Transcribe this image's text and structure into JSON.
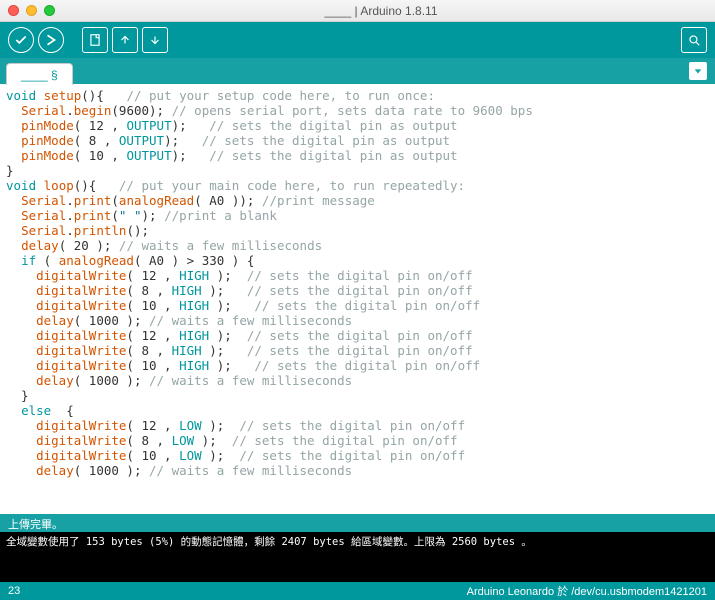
{
  "titlebar": {
    "title": "____ | Arduino 1.8.11"
  },
  "tab": {
    "label": "____ §"
  },
  "code_lines": [
    [
      {
        "t": "kw",
        "v": "void"
      },
      {
        "t": "p",
        "v": " "
      },
      {
        "t": "fn",
        "v": "setup"
      },
      {
        "t": "p",
        "v": "(){   "
      },
      {
        "t": "cm",
        "v": "// put your setup code here, to run once:"
      }
    ],
    [
      {
        "t": "p",
        "v": "  "
      },
      {
        "t": "fn",
        "v": "Serial"
      },
      {
        "t": "p",
        "v": "."
      },
      {
        "t": "fn",
        "v": "begin"
      },
      {
        "t": "p",
        "v": "(9600); "
      },
      {
        "t": "cm",
        "v": "// opens serial port, sets data rate to 9600 bps"
      }
    ],
    [
      {
        "t": "p",
        "v": "  "
      },
      {
        "t": "fn",
        "v": "pinMode"
      },
      {
        "t": "p",
        "v": "( 12 , "
      },
      {
        "t": "kw",
        "v": "OUTPUT"
      },
      {
        "t": "p",
        "v": ");   "
      },
      {
        "t": "cm",
        "v": "// sets the digital pin as output"
      }
    ],
    [
      {
        "t": "p",
        "v": "  "
      },
      {
        "t": "fn",
        "v": "pinMode"
      },
      {
        "t": "p",
        "v": "( 8 , "
      },
      {
        "t": "kw",
        "v": "OUTPUT"
      },
      {
        "t": "p",
        "v": ");   "
      },
      {
        "t": "cm",
        "v": "// sets the digital pin as output"
      }
    ],
    [
      {
        "t": "p",
        "v": "  "
      },
      {
        "t": "fn",
        "v": "pinMode"
      },
      {
        "t": "p",
        "v": "( 10 , "
      },
      {
        "t": "kw",
        "v": "OUTPUT"
      },
      {
        "t": "p",
        "v": ");   "
      },
      {
        "t": "cm",
        "v": "// sets the digital pin as output"
      }
    ],
    [
      {
        "t": "p",
        "v": "}"
      }
    ],
    [
      {
        "t": "p",
        "v": ""
      }
    ],
    [
      {
        "t": "kw",
        "v": "void"
      },
      {
        "t": "p",
        "v": " "
      },
      {
        "t": "fn",
        "v": "loop"
      },
      {
        "t": "p",
        "v": "(){   "
      },
      {
        "t": "cm",
        "v": "// put your main code here, to run repeatedly:"
      }
    ],
    [
      {
        "t": "p",
        "v": "  "
      },
      {
        "t": "fn",
        "v": "Serial"
      },
      {
        "t": "p",
        "v": "."
      },
      {
        "t": "fn",
        "v": "print"
      },
      {
        "t": "p",
        "v": "("
      },
      {
        "t": "fn",
        "v": "analogRead"
      },
      {
        "t": "p",
        "v": "( A0 )); "
      },
      {
        "t": "cm",
        "v": "//print message"
      }
    ],
    [
      {
        "t": "p",
        "v": "  "
      },
      {
        "t": "fn",
        "v": "Serial"
      },
      {
        "t": "p",
        "v": "."
      },
      {
        "t": "fn",
        "v": "print"
      },
      {
        "t": "p",
        "v": "("
      },
      {
        "t": "str",
        "v": "\" \""
      },
      {
        "t": "p",
        "v": "); "
      },
      {
        "t": "cm",
        "v": "//print a blank"
      }
    ],
    [
      {
        "t": "p",
        "v": "  "
      },
      {
        "t": "fn",
        "v": "Serial"
      },
      {
        "t": "p",
        "v": "."
      },
      {
        "t": "fn",
        "v": "println"
      },
      {
        "t": "p",
        "v": "();"
      }
    ],
    [
      {
        "t": "p",
        "v": "  "
      },
      {
        "t": "fn",
        "v": "delay"
      },
      {
        "t": "p",
        "v": "( 20 ); "
      },
      {
        "t": "cm",
        "v": "// waits a few milliseconds"
      }
    ],
    [
      {
        "t": "p",
        "v": "  "
      },
      {
        "t": "kw",
        "v": "if"
      },
      {
        "t": "p",
        "v": " ( "
      },
      {
        "t": "fn",
        "v": "analogRead"
      },
      {
        "t": "p",
        "v": "( A0 ) > 330 ) {"
      }
    ],
    [
      {
        "t": "p",
        "v": "    "
      },
      {
        "t": "fn",
        "v": "digitalWrite"
      },
      {
        "t": "p",
        "v": "( 12 , "
      },
      {
        "t": "kw",
        "v": "HIGH"
      },
      {
        "t": "p",
        "v": " );  "
      },
      {
        "t": "cm",
        "v": "// sets the digital pin on/off"
      }
    ],
    [
      {
        "t": "p",
        "v": "    "
      },
      {
        "t": "fn",
        "v": "digitalWrite"
      },
      {
        "t": "p",
        "v": "( 8 , "
      },
      {
        "t": "kw",
        "v": "HIGH"
      },
      {
        "t": "p",
        "v": " );   "
      },
      {
        "t": "cm",
        "v": "// sets the digital pin on/off"
      }
    ],
    [
      {
        "t": "p",
        "v": "    "
      },
      {
        "t": "fn",
        "v": "digitalWrite"
      },
      {
        "t": "p",
        "v": "( 10 , "
      },
      {
        "t": "kw",
        "v": "HIGH"
      },
      {
        "t": "p",
        "v": " );   "
      },
      {
        "t": "cm",
        "v": "// sets the digital pin on/off"
      }
    ],
    [
      {
        "t": "p",
        "v": "    "
      },
      {
        "t": "fn",
        "v": "delay"
      },
      {
        "t": "p",
        "v": "( 1000 ); "
      },
      {
        "t": "cm",
        "v": "// waits a few milliseconds"
      }
    ],
    [
      {
        "t": "p",
        "v": "    "
      },
      {
        "t": "fn",
        "v": "digitalWrite"
      },
      {
        "t": "p",
        "v": "( 12 , "
      },
      {
        "t": "kw",
        "v": "HIGH"
      },
      {
        "t": "p",
        "v": " );  "
      },
      {
        "t": "cm",
        "v": "// sets the digital pin on/off"
      }
    ],
    [
      {
        "t": "p",
        "v": "    "
      },
      {
        "t": "fn",
        "v": "digitalWrite"
      },
      {
        "t": "p",
        "v": "( 8 , "
      },
      {
        "t": "kw",
        "v": "HIGH"
      },
      {
        "t": "p",
        "v": " );   "
      },
      {
        "t": "cm",
        "v": "// sets the digital pin on/off"
      }
    ],
    [
      {
        "t": "p",
        "v": "    "
      },
      {
        "t": "fn",
        "v": "digitalWrite"
      },
      {
        "t": "p",
        "v": "( 10 , "
      },
      {
        "t": "kw",
        "v": "HIGH"
      },
      {
        "t": "p",
        "v": " );   "
      },
      {
        "t": "cm",
        "v": "// sets the digital pin on/off"
      }
    ],
    [
      {
        "t": "p",
        "v": "    "
      },
      {
        "t": "fn",
        "v": "delay"
      },
      {
        "t": "p",
        "v": "( 1000 ); "
      },
      {
        "t": "cm",
        "v": "// waits a few milliseconds"
      }
    ],
    [
      {
        "t": "p",
        "v": "  }"
      }
    ],
    [
      {
        "t": "p",
        "v": "  "
      },
      {
        "t": "kw",
        "v": "else"
      },
      {
        "t": "p",
        "v": "  {"
      }
    ],
    [
      {
        "t": "p",
        "v": "    "
      },
      {
        "t": "fn",
        "v": "digitalWrite"
      },
      {
        "t": "p",
        "v": "( 12 , "
      },
      {
        "t": "kw",
        "v": "LOW"
      },
      {
        "t": "p",
        "v": " );  "
      },
      {
        "t": "cm",
        "v": "// sets the digital pin on/off"
      }
    ],
    [
      {
        "t": "p",
        "v": "    "
      },
      {
        "t": "fn",
        "v": "digitalWrite"
      },
      {
        "t": "p",
        "v": "( 8 , "
      },
      {
        "t": "kw",
        "v": "LOW"
      },
      {
        "t": "p",
        "v": " );  "
      },
      {
        "t": "cm",
        "v": "// sets the digital pin on/off"
      }
    ],
    [
      {
        "t": "p",
        "v": "    "
      },
      {
        "t": "fn",
        "v": "digitalWrite"
      },
      {
        "t": "p",
        "v": "( 10 , "
      },
      {
        "t": "kw",
        "v": "LOW"
      },
      {
        "t": "p",
        "v": " );  "
      },
      {
        "t": "cm",
        "v": "// sets the digital pin on/off"
      }
    ],
    [
      {
        "t": "p",
        "v": "    "
      },
      {
        "t": "fn",
        "v": "delay"
      },
      {
        "t": "p",
        "v": "( 1000 ); "
      },
      {
        "t": "cm",
        "v": "// waits a few milliseconds"
      }
    ]
  ],
  "status": {
    "label": "上傳完畢。"
  },
  "console": {
    "text": "全域變數使用了 153 bytes (5%) 的動態記憶體，剩餘 2407 bytes 給區域變數。上限為 2560 bytes 。"
  },
  "footer": {
    "line": "23",
    "board": "Arduino Leonardo 於 /dev/cu.usbmodem1421201"
  }
}
